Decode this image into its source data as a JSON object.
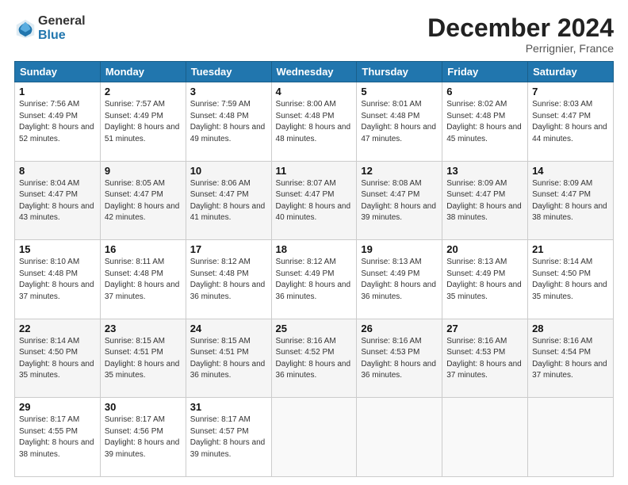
{
  "header": {
    "logo_general": "General",
    "logo_blue": "Blue",
    "month_title": "December 2024",
    "location": "Perrignier, France"
  },
  "days_of_week": [
    "Sunday",
    "Monday",
    "Tuesday",
    "Wednesday",
    "Thursday",
    "Friday",
    "Saturday"
  ],
  "weeks": [
    [
      {
        "day": "1",
        "sunrise": "7:56 AM",
        "sunset": "4:49 PM",
        "daylight": "8 hours and 52 minutes."
      },
      {
        "day": "2",
        "sunrise": "7:57 AM",
        "sunset": "4:49 PM",
        "daylight": "8 hours and 51 minutes."
      },
      {
        "day": "3",
        "sunrise": "7:59 AM",
        "sunset": "4:48 PM",
        "daylight": "8 hours and 49 minutes."
      },
      {
        "day": "4",
        "sunrise": "8:00 AM",
        "sunset": "4:48 PM",
        "daylight": "8 hours and 48 minutes."
      },
      {
        "day": "5",
        "sunrise": "8:01 AM",
        "sunset": "4:48 PM",
        "daylight": "8 hours and 47 minutes."
      },
      {
        "day": "6",
        "sunrise": "8:02 AM",
        "sunset": "4:48 PM",
        "daylight": "8 hours and 45 minutes."
      },
      {
        "day": "7",
        "sunrise": "8:03 AM",
        "sunset": "4:47 PM",
        "daylight": "8 hours and 44 minutes."
      }
    ],
    [
      {
        "day": "8",
        "sunrise": "8:04 AM",
        "sunset": "4:47 PM",
        "daylight": "8 hours and 43 minutes."
      },
      {
        "day": "9",
        "sunrise": "8:05 AM",
        "sunset": "4:47 PM",
        "daylight": "8 hours and 42 minutes."
      },
      {
        "day": "10",
        "sunrise": "8:06 AM",
        "sunset": "4:47 PM",
        "daylight": "8 hours and 41 minutes."
      },
      {
        "day": "11",
        "sunrise": "8:07 AM",
        "sunset": "4:47 PM",
        "daylight": "8 hours and 40 minutes."
      },
      {
        "day": "12",
        "sunrise": "8:08 AM",
        "sunset": "4:47 PM",
        "daylight": "8 hours and 39 minutes."
      },
      {
        "day": "13",
        "sunrise": "8:09 AM",
        "sunset": "4:47 PM",
        "daylight": "8 hours and 38 minutes."
      },
      {
        "day": "14",
        "sunrise": "8:09 AM",
        "sunset": "4:47 PM",
        "daylight": "8 hours and 38 minutes."
      }
    ],
    [
      {
        "day": "15",
        "sunrise": "8:10 AM",
        "sunset": "4:48 PM",
        "daylight": "8 hours and 37 minutes."
      },
      {
        "day": "16",
        "sunrise": "8:11 AM",
        "sunset": "4:48 PM",
        "daylight": "8 hours and 37 minutes."
      },
      {
        "day": "17",
        "sunrise": "8:12 AM",
        "sunset": "4:48 PM",
        "daylight": "8 hours and 36 minutes."
      },
      {
        "day": "18",
        "sunrise": "8:12 AM",
        "sunset": "4:49 PM",
        "daylight": "8 hours and 36 minutes."
      },
      {
        "day": "19",
        "sunrise": "8:13 AM",
        "sunset": "4:49 PM",
        "daylight": "8 hours and 36 minutes."
      },
      {
        "day": "20",
        "sunrise": "8:13 AM",
        "sunset": "4:49 PM",
        "daylight": "8 hours and 35 minutes."
      },
      {
        "day": "21",
        "sunrise": "8:14 AM",
        "sunset": "4:50 PM",
        "daylight": "8 hours and 35 minutes."
      }
    ],
    [
      {
        "day": "22",
        "sunrise": "8:14 AM",
        "sunset": "4:50 PM",
        "daylight": "8 hours and 35 minutes."
      },
      {
        "day": "23",
        "sunrise": "8:15 AM",
        "sunset": "4:51 PM",
        "daylight": "8 hours and 35 minutes."
      },
      {
        "day": "24",
        "sunrise": "8:15 AM",
        "sunset": "4:51 PM",
        "daylight": "8 hours and 36 minutes."
      },
      {
        "day": "25",
        "sunrise": "8:16 AM",
        "sunset": "4:52 PM",
        "daylight": "8 hours and 36 minutes."
      },
      {
        "day": "26",
        "sunrise": "8:16 AM",
        "sunset": "4:53 PM",
        "daylight": "8 hours and 36 minutes."
      },
      {
        "day": "27",
        "sunrise": "8:16 AM",
        "sunset": "4:53 PM",
        "daylight": "8 hours and 37 minutes."
      },
      {
        "day": "28",
        "sunrise": "8:16 AM",
        "sunset": "4:54 PM",
        "daylight": "8 hours and 37 minutes."
      }
    ],
    [
      {
        "day": "29",
        "sunrise": "8:17 AM",
        "sunset": "4:55 PM",
        "daylight": "8 hours and 38 minutes."
      },
      {
        "day": "30",
        "sunrise": "8:17 AM",
        "sunset": "4:56 PM",
        "daylight": "8 hours and 39 minutes."
      },
      {
        "day": "31",
        "sunrise": "8:17 AM",
        "sunset": "4:57 PM",
        "daylight": "8 hours and 39 minutes."
      },
      null,
      null,
      null,
      null
    ]
  ]
}
